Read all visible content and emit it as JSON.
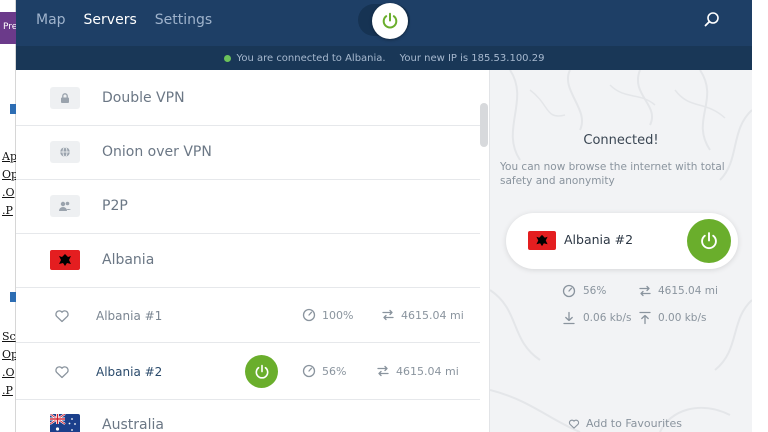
{
  "background": {
    "left_fragments": [
      "Pre",
      "Ap",
      "Op",
      ".O",
      ".P",
      "Sc",
      "Op",
      ".O",
      ".P"
    ]
  },
  "nav": {
    "tabs": [
      {
        "label": "Map",
        "active": false
      },
      {
        "label": "Servers",
        "active": true
      },
      {
        "label": "Settings",
        "active": false
      }
    ]
  },
  "status": {
    "connected_text": "You are connected to Albania.",
    "ip_text": "Your new IP is 185.53.100.29"
  },
  "categories": [
    {
      "label": "Double VPN",
      "icon": "lock-icon"
    },
    {
      "label": "Onion over VPN",
      "icon": "onion-icon"
    },
    {
      "label": "P2P",
      "icon": "users-icon"
    }
  ],
  "countries": {
    "albania": "Albania",
    "australia": "Australia"
  },
  "servers": [
    {
      "name": "Albania #1",
      "load": "100%",
      "distance": "4615.04 mi",
      "active": false
    },
    {
      "name": "Albania #2",
      "load": "56%",
      "distance": "4615.04 mi",
      "active": true
    }
  ],
  "detail": {
    "title": "Connected!",
    "subtitle": "You can now browse the internet with total safety and anonymity",
    "server_name": "Albania #2",
    "load": "56%",
    "distance": "4615.04 mi",
    "download": "0.06 kb/s",
    "upload": "0.00 kb/s",
    "favourite_label": "Add to Favourites"
  },
  "colors": {
    "topbar": "#1e3f66",
    "accent_green": "#6aae2c",
    "albania_red": "#e41e20",
    "status_dot": "#6cc25a"
  }
}
